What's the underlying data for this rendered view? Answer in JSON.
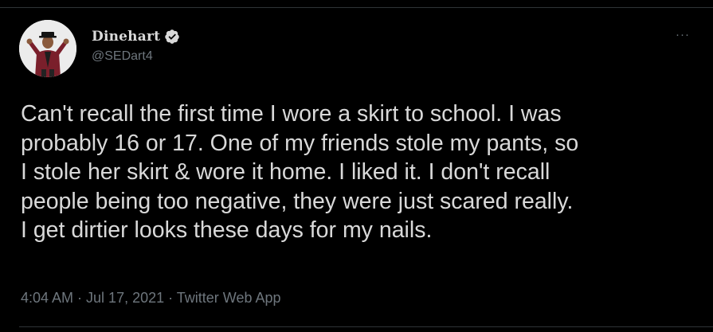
{
  "tweet": {
    "author": {
      "display_name": "Dinehart",
      "handle": "@SEDart4",
      "verified": true,
      "avatar_icon": "user-avatar",
      "verified_icon": "verified-badge-icon"
    },
    "more_label": "···",
    "text_lines": [
      "Can't recall the first time I wore a skirt to school. I was",
      "probably 16 or 17. One of my friends stole my pants, so",
      "I stole her skirt & wore it home. I liked it. I don't recall",
      "people being too negative, they were just scared really.",
      "I get dirtier looks these days for my nails."
    ],
    "time": "4:04 AM",
    "separator": " · ",
    "date": "Jul 17, 2021",
    "source": "Twitter Web App"
  },
  "colors": {
    "background": "#000000",
    "text": "#d9d9d9",
    "secondary": "#6e767d",
    "divider": "#2f3336"
  }
}
